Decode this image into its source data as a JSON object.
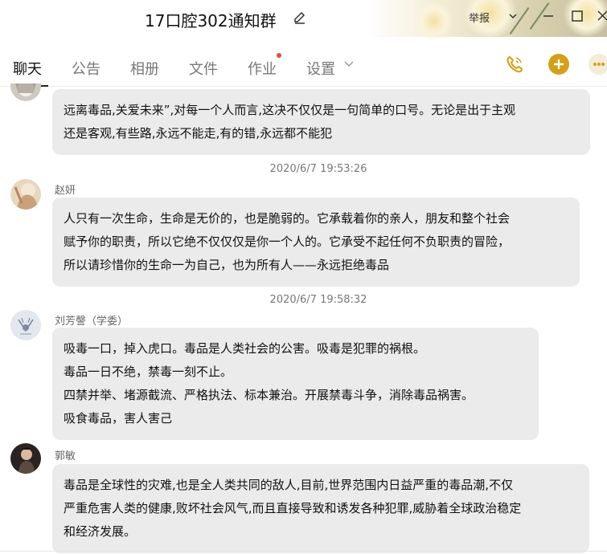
{
  "window": {
    "title": "17口腔302通知群",
    "report_label": "举报"
  },
  "tabs": [
    {
      "label": "聊天",
      "active": true
    },
    {
      "label": "公告",
      "active": false
    },
    {
      "label": "相册",
      "active": false
    },
    {
      "label": "文件",
      "active": false
    },
    {
      "label": "作业",
      "active": false,
      "has_dot": true
    },
    {
      "label": "设置",
      "active": false,
      "has_dropdown": true
    }
  ],
  "toolbar_icons": [
    "phone-call-icon",
    "add-icon",
    "more-icon"
  ],
  "colors": {
    "accent_gold": "#d4a017",
    "bubble_bg": "#ebebeb",
    "notification_dot": "#e54a3c"
  },
  "messages": [
    {
      "sender": "",
      "lines": [
        "远离毒品,关爱未来”,对每一个人而言,这决不仅仅是一句简单的口号。无论是出于主观",
        "还是客观,有些路,永远不能走,有的错,永远都不能犯"
      ]
    },
    {
      "timestamp": "2020/6/7 19:53:26",
      "sender": "赵妍",
      "lines": [
        "人只有一次生命，生命是无价的，也是脆弱的。它承载着你的亲人，朋友和整个社会",
        "赋予你的职责，所以它绝不仅仅仅是你一个人的。它承受不起任何不负职责的冒险，",
        "所以请珍惜你的生命一为自己，也为所有人——永远拒绝毒品"
      ]
    },
    {
      "timestamp": "2020/6/7 19:58:32",
      "sender": "刘芳謦（学委）",
      "lines": [
        "吸毒一口，掉入虎口。毒品是人类社会的公害。吸毒是犯罪的祸根。",
        "毒品一日不绝，禁毒一刻不止。",
        "四禁并举、堵源截流、严格执法、标本兼治。开展禁毒斗争，消除毒品祸害。",
        "吸食毒品，害人害己"
      ]
    },
    {
      "sender": "郭敏",
      "lines": [
        "毒品是全球性的灾难,也是全人类共同的敌人,目前,世界范围内日益严重的毒品潮,不仅",
        "严重危害人类的健康,败坏社会风气,而且直接导致和诱发各种犯罪,威胁着全球政治稳定",
        "和经济发展。"
      ]
    }
  ]
}
